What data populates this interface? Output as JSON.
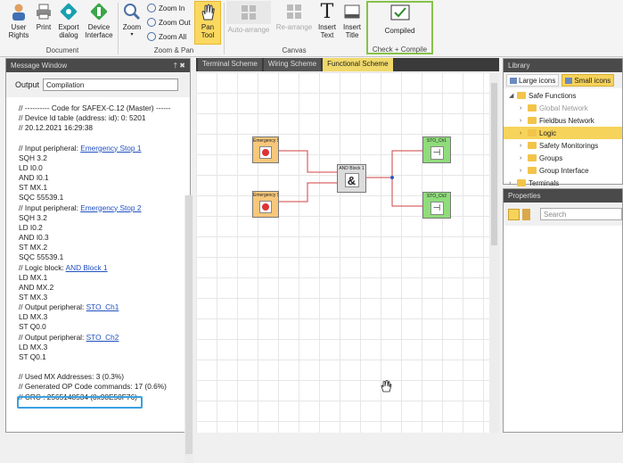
{
  "ribbon": {
    "user_rights": "User\nRights",
    "print": "Print",
    "export_dialog": "Export\ndialog",
    "device_interface": "Device\nInterface",
    "document_group": "Document",
    "zoom": "Zoom",
    "zoom_in": "Zoom In",
    "zoom_out": "Zoom Out",
    "zoom_all": "Zoom All",
    "pan_tool": "Pan\nTool",
    "zoom_pan_group": "Zoom & Pan",
    "auto_arrange": "Auto-arrange",
    "re_arrange": "Re-arrange",
    "insert_text": "Insert\nText",
    "insert_title": "Insert\nTitle",
    "canvas_group": "Canvas",
    "compiled": "Compiled",
    "check_compile_group": "Check + Compile"
  },
  "message_window": {
    "title": "Message Window",
    "pin": "† ✖",
    "output_label": "Output",
    "output_value": "Compilation",
    "lines": [
      {
        "t": "// ---------- Code for SAFEX-C.12 (Master) ------"
      },
      {
        "t": "// Device Id table (address: id): 0: 5201"
      },
      {
        "t": "// 20.12.2021 16:29:38"
      },
      {
        "t": ""
      },
      {
        "t": "// Input peripheral: ",
        "link": "Emergency Stop 1"
      },
      {
        "t": "SQH 3.2"
      },
      {
        "t": "LD I0.0"
      },
      {
        "t": "AND I0.1"
      },
      {
        "t": "ST MX.1"
      },
      {
        "t": "SQC 55539.1"
      },
      {
        "t": "// Input peripheral: ",
        "link": "Emergency Stop 2"
      },
      {
        "t": "SQH 3.2"
      },
      {
        "t": "LD I0.2"
      },
      {
        "t": "AND I0.3"
      },
      {
        "t": "ST MX.2"
      },
      {
        "t": "SQC 55539.1"
      },
      {
        "t": "// Logic block: ",
        "link": "AND Block 1"
      },
      {
        "t": "LD MX.1"
      },
      {
        "t": "AND MX.2"
      },
      {
        "t": "ST MX.3"
      },
      {
        "t": "// Output peripheral: ",
        "link": "STO_Ch1"
      },
      {
        "t": "LD MX.3"
      },
      {
        "t": "ST Q0.0"
      },
      {
        "t": "// Output peripheral: ",
        "link": "STO_Ch2"
      },
      {
        "t": "LD MX.3"
      },
      {
        "t": "ST Q0.1"
      },
      {
        "t": ""
      },
      {
        "t": "// Used MX Addresses: 3 (0.3%)"
      },
      {
        "t": "// Generated OP Code commands: 17 (0.6%)"
      },
      {
        "t": "// CRC : 2565148534 (0x98E50F76)"
      }
    ]
  },
  "tabs": [
    "Terminal Scheme",
    "Wiring Scheme",
    "Functional Scheme"
  ],
  "active_tab": "Functional Scheme",
  "blocks": {
    "estop1": "Emergency S",
    "estop2": "Emergency S",
    "and1": "AND Block 1",
    "sto1": "STO_Ch1",
    "sto2": "STO_Ch2"
  },
  "library": {
    "title": "Library",
    "large_icons": "Large icons",
    "small_icons": "Small icons",
    "tree": [
      {
        "label": "Safe Functions",
        "arrow": "◢",
        "indent": 0
      },
      {
        "label": "Global Network",
        "arrow": "›",
        "indent": 1,
        "dim": true
      },
      {
        "label": "Fieldbus Network",
        "arrow": "›",
        "indent": 1
      },
      {
        "label": "Logic",
        "arrow": "›",
        "indent": 1,
        "selected": true
      },
      {
        "label": "Safety Monitorings",
        "arrow": "›",
        "indent": 1
      },
      {
        "label": "Groups",
        "arrow": "›",
        "indent": 1
      },
      {
        "label": "Group Interface",
        "arrow": "›",
        "indent": 1
      },
      {
        "label": "Terminals",
        "arrow": "›",
        "indent": 0
      }
    ]
  },
  "properties": {
    "title": "Properties",
    "search_placeholder": "Search"
  },
  "colors": {
    "accent_yellow": "#f6d35a",
    "compiled_border": "#86c24a",
    "crc_highlight": "#3aa0e0",
    "wire_red": "#d04040",
    "input_block": "#f7c77a",
    "output_block": "#8fdc7a"
  }
}
